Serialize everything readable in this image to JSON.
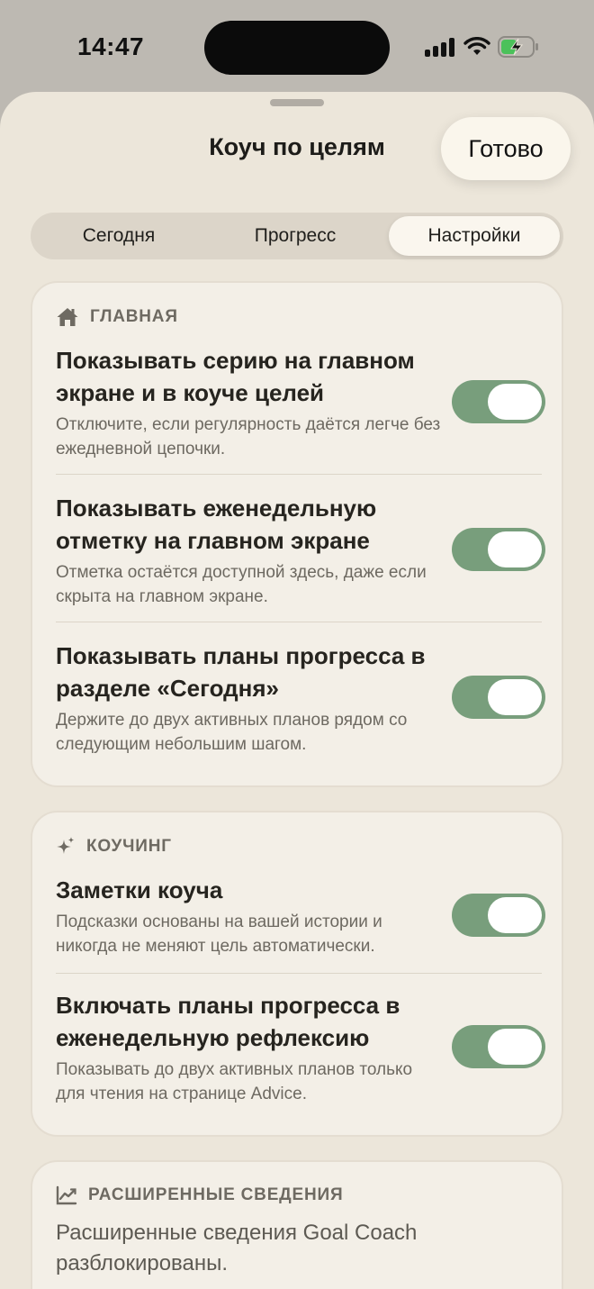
{
  "status_bar": {
    "time": "14:47",
    "icons": [
      "cellular-signal-icon",
      "wifi-icon",
      "battery-charging-icon"
    ]
  },
  "sheet": {
    "title": "Коуч по целям",
    "done_label": "Готово"
  },
  "tabs": [
    {
      "label": "Сегодня",
      "selected": false
    },
    {
      "label": "Прогресс",
      "selected": false
    },
    {
      "label": "Настройки",
      "selected": true
    }
  ],
  "home_section": {
    "icon": "house-icon",
    "header": "ГЛАВНАЯ",
    "items": [
      {
        "title": "Показывать серию на главном экране и в коуче целей",
        "subtitle": "Отключите, если регулярность даётся легче без ежедневной цепочки.",
        "enabled": true
      },
      {
        "title": "Показывать еженедельную отметку на главном экране",
        "subtitle": "Отметка остаётся доступной здесь, даже если скрыта на главном экране.",
        "enabled": true
      },
      {
        "title": "Показывать планы прогресса в разделе «Сегодня»",
        "subtitle": "Держите до двух активных планов рядом со следующим небольшим шагом.",
        "enabled": true
      }
    ]
  },
  "coaching_section": {
    "icon": "sparkles-icon",
    "header": "КОУЧИНГ",
    "items": [
      {
        "title": "Заметки коуча",
        "subtitle": "Подсказки основаны на вашей истории и никогда не меняют цель автоматически.",
        "enabled": true
      },
      {
        "title": "Включать планы прогресса в еженедельную рефлексию",
        "subtitle": "Показывать до двух активных планов только для чтения на странице Advice.",
        "enabled": true
      }
    ]
  },
  "advanced_section": {
    "icon": "chart-line-icon",
    "header": "РАСШИРЕННЫЕ СВЕДЕНИЯ",
    "text": "Расширенные сведения Goal Coach разблокированы."
  },
  "colors": {
    "toggle_on": "#789e7c",
    "sheet_bg": "#ece6da",
    "card_bg": "#f3efe7"
  }
}
